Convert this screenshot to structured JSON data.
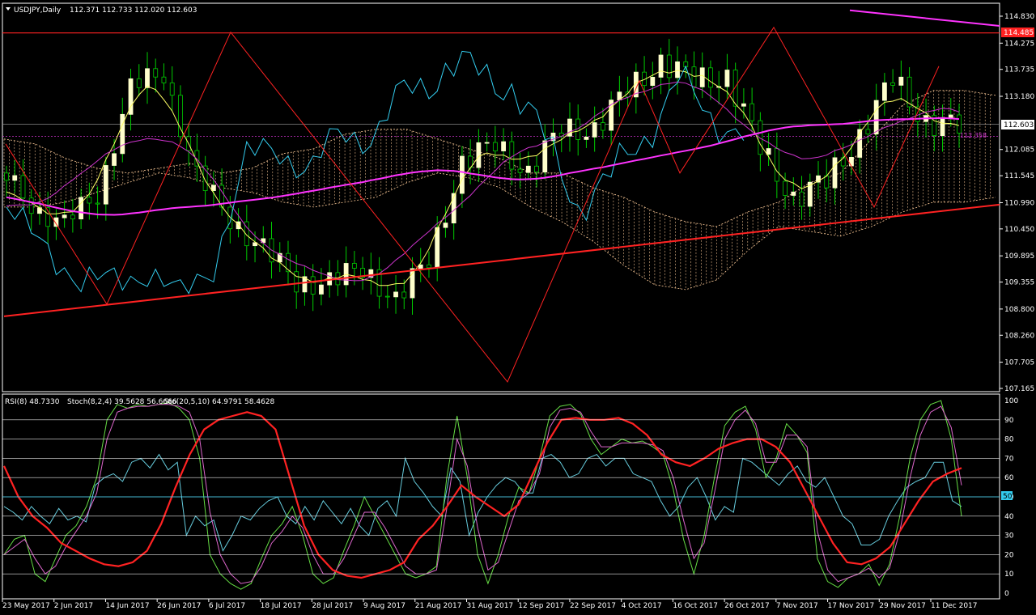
{
  "colors": {
    "background": "#000000",
    "grid": "#ffffff",
    "candle_bull": "#ffffcc",
    "candle_bear_wick": "#00cc00",
    "ichimoku_tenkan": "#ffff66",
    "ichimoku_kijun": "#cc33cc",
    "chikou": "#33ccee",
    "cloud": "#ffcc99",
    "ma": "#ff33ff",
    "trendline": "#ff2222",
    "zigzag": "#ff2222",
    "rsi": "#66ccdd",
    "stoch_fast": "#66dd44",
    "stoch_slow": "#dd66cc",
    "stoch_long": "#ff2222"
  },
  "header": {
    "menu_icon": "triangle-down-icon",
    "symbol": "USDJPY,Daily",
    "ohlc": "112.371 112.733 112.020 112.603"
  },
  "indicator_header": {
    "rsi": "RSI(8) 48.7330",
    "stoch_fast": "Stoch(8,2,4) 39.5628 56.6666",
    "stoch_long": "Sto(20,5,10) 64.9791 58.4628"
  },
  "current_price_label": "112.603",
  "hline_price_label": "114.485",
  "ichimoku_label": "112.358",
  "price_axis_ticks": [
    "114.830",
    "114.275",
    "113.735",
    "113.180",
    "112.085",
    "111.545",
    "110.990",
    "110.450",
    "109.895",
    "109.355",
    "108.800",
    "108.260",
    "107.705",
    "107.165"
  ],
  "osc_axis_ticks": [
    "100",
    "90",
    "80",
    "70",
    "60",
    "50",
    "40",
    "30",
    "20",
    "10",
    "0"
  ],
  "date_ticks": [
    "23 May 2017",
    "2 Jun 2017",
    "14 Jun 2017",
    "26 Jun 2017",
    "6 Jul 2017",
    "18 Jul 2017",
    "28 Jul 2017",
    "9 Aug 2017",
    "21 Aug 2017",
    "31 Aug 2017",
    "12 Sep 2017",
    "22 Sep 2017",
    "4 Oct 2017",
    "16 Oct 2017",
    "26 Oct 2017",
    "7 Nov 2017",
    "17 Nov 2017",
    "29 Nov 2017",
    "11 Dec 2017"
  ],
  "chart_data": [
    {
      "type": "candlestick",
      "title": "USDJPY,Daily",
      "ylim": [
        107.165,
        114.83
      ],
      "x": [
        "23 May 2017",
        "2 Jun 2017",
        "14 Jun 2017",
        "26 Jun 2017",
        "6 Jul 2017",
        "18 Jul 2017",
        "28 Jul 2017",
        "9 Aug 2017",
        "21 Aug 2017",
        "31 Aug 2017",
        "12 Sep 2017",
        "22 Sep 2017",
        "4 Oct 2017",
        "16 Oct 2017",
        "26 Oct 2017",
        "7 Nov 2017",
        "17 Nov 2017",
        "29 Nov 2017",
        "11 Dec 2017"
      ],
      "series": [
        {
          "values": [
            111.6,
            111.0,
            110.5,
            111.2,
            113.3,
            113.7,
            111.5,
            110.7,
            110.0,
            109.4,
            109.3,
            109.7,
            108.9,
            109.9,
            111.7,
            112.3,
            111.5,
            112.6,
            112.4,
            113.4,
            113.8,
            113.6,
            113.5,
            112.2,
            111.0,
            111.5,
            112.3,
            113.6,
            112.6
          ],
          "ohlc_last": [
            112.371,
            112.733,
            112.02,
            112.603
          ]
        }
      ],
      "hlines": [
        114.485
      ],
      "current_price": 112.603,
      "ichimoku_marker": 112.358,
      "grid": false
    },
    {
      "type": "line",
      "ylim": [
        0,
        100
      ],
      "levels": [
        10,
        20,
        30,
        40,
        50,
        60,
        70,
        80,
        90
      ],
      "series": [
        {
          "name": "RSI(8)",
          "last": 48.733
        },
        {
          "name": "Stoch(8,2,4)",
          "last": [
            39.5628,
            56.6666
          ]
        },
        {
          "name": "Sto(20,5,10)",
          "last": [
            64.9791,
            58.4628
          ]
        }
      ],
      "values": {
        "rsi": [
          45,
          42,
          38,
          45,
          40,
          36,
          44,
          38,
          40,
          37,
          56,
          60,
          62,
          58,
          68,
          70,
          65,
          72,
          64,
          68,
          30,
          40,
          35,
          38,
          22,
          30,
          40,
          38,
          44,
          48,
          50,
          40,
          36,
          45,
          38,
          48,
          42,
          36,
          44,
          35,
          30,
          44,
          48,
          40,
          70,
          58,
          52,
          45,
          40,
          65,
          58,
          30,
          42,
          50,
          56,
          60,
          58,
          52,
          52,
          70,
          72,
          68,
          60,
          62,
          70,
          72,
          66,
          70,
          70,
          62,
          60,
          58,
          48,
          40,
          45,
          55,
          60,
          50,
          38,
          45,
          42,
          70,
          68,
          64,
          60,
          56,
          62,
          66,
          58,
          55,
          60,
          50,
          40,
          36,
          25,
          25,
          28,
          40,
          48,
          55,
          58,
          60,
          68,
          68,
          48,
          45
        ],
        "stoch_fast": [
          20,
          28,
          30,
          10,
          6,
          18,
          30,
          35,
          45,
          60,
          90,
          98,
          96,
          98,
          97,
          98,
          99,
          96,
          90,
          70,
          20,
          10,
          5,
          2,
          5,
          18,
          30,
          36,
          45,
          30,
          10,
          5,
          8,
          22,
          35,
          50,
          40,
          30,
          20,
          10,
          8,
          10,
          14,
          60,
          92,
          60,
          20,
          5,
          20,
          40,
          55,
          52,
          70,
          92,
          97,
          98,
          93,
          80,
          72,
          76,
          80,
          78,
          79,
          76,
          72,
          54,
          28,
          10,
          30,
          60,
          87,
          94,
          97,
          85,
          60,
          70,
          88,
          82,
          73,
          18,
          6,
          3,
          8,
          10,
          15,
          4,
          15,
          40,
          70,
          90,
          98,
          100,
          80,
          40
        ],
        "stoch_slow": [
          20,
          24,
          28,
          18,
          10,
          14,
          24,
          32,
          40,
          52,
          80,
          94,
          96,
          97,
          97,
          98,
          98,
          97,
          94,
          80,
          42,
          20,
          10,
          5,
          6,
          14,
          26,
          32,
          40,
          34,
          20,
          10,
          10,
          18,
          30,
          42,
          42,
          34,
          24,
          14,
          10,
          10,
          12,
          44,
          80,
          66,
          34,
          12,
          16,
          32,
          48,
          52,
          62,
          86,
          95,
          96,
          94,
          84,
          76,
          76,
          78,
          78,
          78,
          77,
          74,
          60,
          38,
          18,
          26,
          52,
          80,
          90,
          95,
          88,
          68,
          68,
          82,
          82,
          76,
          32,
          12,
          6,
          8,
          10,
          13,
          8,
          13,
          32,
          60,
          82,
          94,
          97,
          86,
          56
        ],
        "stoch_long": [
          66,
          50,
          40,
          34,
          26,
          22,
          18,
          15,
          14,
          16,
          22,
          36,
          55,
          72,
          85,
          90,
          92,
          94,
          92,
          85,
          60,
          35,
          20,
          12,
          9,
          8,
          10,
          12,
          16,
          28,
          35,
          45,
          56,
          50,
          45,
          40,
          46,
          62,
          78,
          90,
          91,
          90,
          90,
          91,
          88,
          82,
          72,
          68,
          66,
          70,
          75,
          78,
          80,
          80,
          76,
          68,
          54,
          40,
          26,
          16,
          15,
          18,
          24,
          36,
          48,
          58,
          62,
          65
        ]
      }
    }
  ]
}
